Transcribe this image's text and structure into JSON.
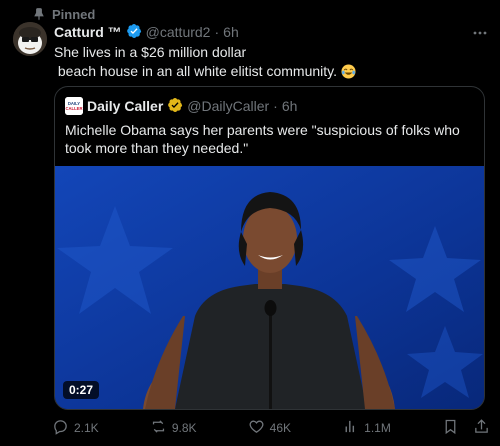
{
  "pinned": {
    "label": "Pinned"
  },
  "tweet": {
    "author_name": "Catturd ™",
    "handle": "@catturd2",
    "separator": "·",
    "time": "6h",
    "text_line1": "She lives in a $26 million dollar",
    "text_line2": " beach house in an all white elitist community. ",
    "emoji": "laughing-tears-emoji"
  },
  "quote": {
    "author_name": "Daily Caller",
    "handle": "@DailyCaller",
    "separator": "·",
    "time": "6h",
    "logo_text_top": "DAILY",
    "logo_text_bottom": "CALLER",
    "text": "Michelle Obama says her parents were \"suspicious of folks who took more than they needed.\"",
    "video_duration": "0:27"
  },
  "actions": {
    "replies": "2.1K",
    "reposts": "9.8K",
    "likes": "46K",
    "views": "1.1M"
  },
  "colors": {
    "background": "#000000",
    "text": "#e7e9ea",
    "muted": "#71767b",
    "verified": "#1d9bf0",
    "gold_badge": "#e2b719"
  }
}
